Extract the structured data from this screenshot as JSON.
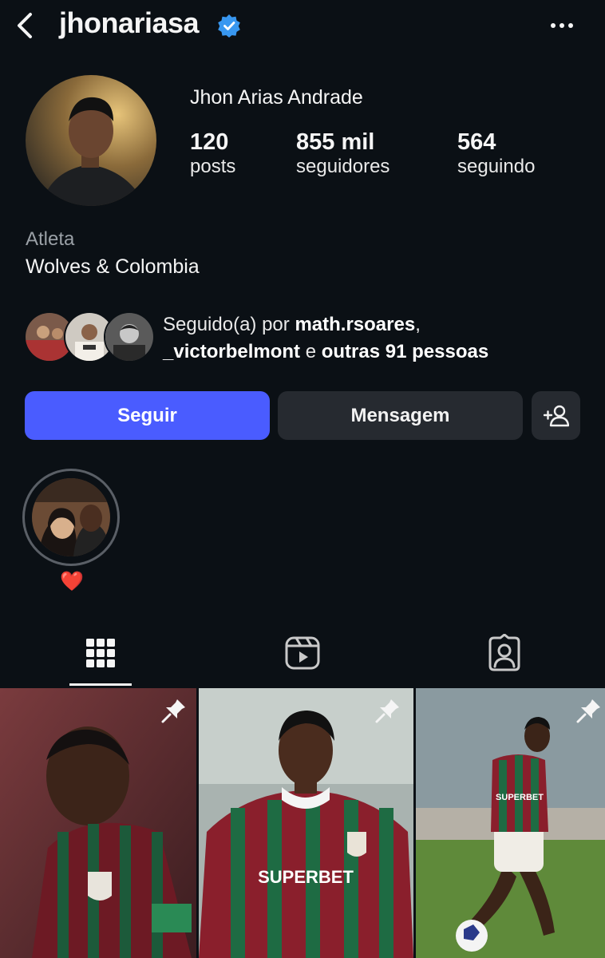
{
  "header": {
    "username": "jhonariasa",
    "back_icon": "back-icon",
    "verified_icon": "verified-icon",
    "more_icon": "more-icon"
  },
  "profile": {
    "full_name": "Jhon Arias Andrade",
    "stats": {
      "posts": {
        "value": "120",
        "label": "posts"
      },
      "followers": {
        "value": "855 mil",
        "label": "seguidores"
      },
      "following": {
        "value": "564",
        "label": "seguindo"
      }
    },
    "category": "Atleta",
    "bio": "Wolves & Colombia",
    "followed_by": {
      "prefix": "Seguido(a) por",
      "user1": "math.rsoares",
      "separator": ",",
      "user2": "_victorbelmont",
      "conjunction": "e",
      "others": "outras 91 pessoas"
    }
  },
  "actions": {
    "follow_label": "Seguir",
    "message_label": "Mensagem",
    "suggest_icon": "add-person-icon"
  },
  "highlights": [
    {
      "label": "❤️"
    }
  ],
  "tabs": [
    {
      "icon": "grid-icon",
      "active": true
    },
    {
      "icon": "reels-icon",
      "active": false
    },
    {
      "icon": "tagged-icon",
      "active": false
    }
  ],
  "posts": [
    {
      "pinned": true,
      "text": ""
    },
    {
      "pinned": true,
      "text": "SUPERBET"
    },
    {
      "pinned": true,
      "text": "SUPERBET"
    }
  ],
  "colors": {
    "background": "#0b1015",
    "follow_button": "#4a5cff",
    "secondary_button": "#262a30",
    "verified": "#3897f0"
  }
}
